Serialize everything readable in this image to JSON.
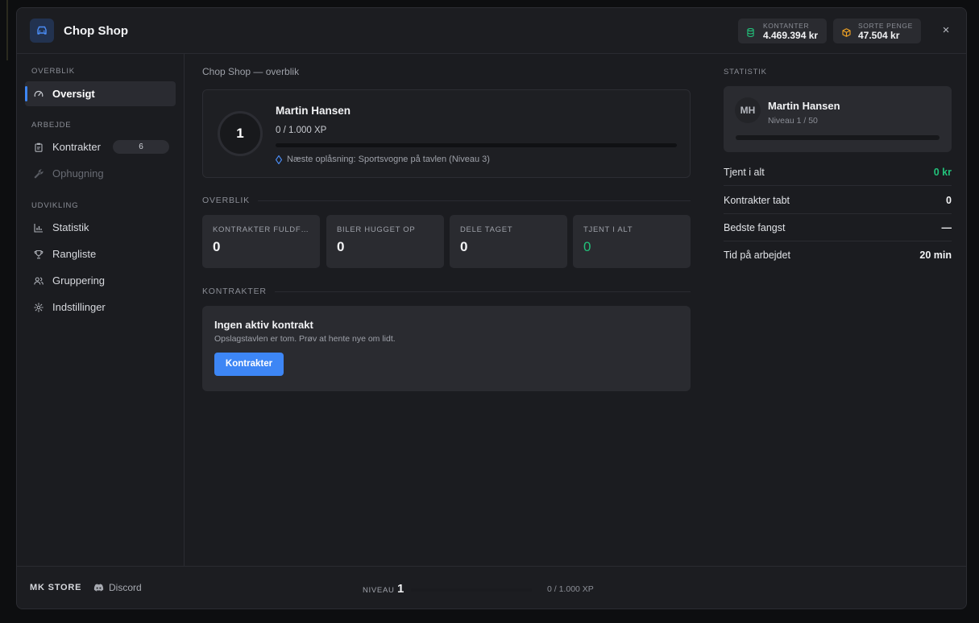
{
  "header": {
    "title": "Chop Shop",
    "wallet": [
      {
        "label": "KONTANTER",
        "value": "4.469.394 kr",
        "icon": "cash-stack-icon",
        "color": "#22c17a"
      },
      {
        "label": "SORTE PENGE",
        "value": "47.504 kr",
        "icon": "box-icon",
        "color": "#f5a524"
      }
    ],
    "close": "×"
  },
  "sidebar": {
    "sections": [
      {
        "label": "OVERBLIK"
      },
      {
        "label": "ARBEJDE"
      },
      {
        "label": "UDVIKLING"
      }
    ],
    "items": [
      {
        "label": "Oversigt",
        "icon": "gauge-icon",
        "active": true
      },
      {
        "label": "Kontrakter",
        "icon": "clipboard-icon",
        "badge": "6"
      },
      {
        "label": "Ophugning",
        "icon": "wrench-icon",
        "disabled": true
      },
      {
        "label": "Statistik",
        "icon": "bar-chart-icon"
      },
      {
        "label": "Rangliste",
        "icon": "trophy-icon"
      },
      {
        "label": "Gruppering",
        "icon": "users-icon"
      },
      {
        "label": "Indstillinger",
        "icon": "gear-icon"
      }
    ]
  },
  "main": {
    "breadcrumb": "Chop Shop — overblik",
    "profile": {
      "level": "1",
      "name": "Martin Hansen",
      "xp": "0 / 1.000 XP",
      "xp_progress": 0,
      "next_unlock": "Næste oplåsning: Sportsvogne på tavlen (Niveau 3)"
    },
    "overview_title": "OVERBLIK",
    "stats": [
      {
        "label": "KONTRAKTER FULDF…",
        "value": "0"
      },
      {
        "label": "BILER HUGGET OP",
        "value": "0"
      },
      {
        "label": "DELE TAGET",
        "value": "0"
      },
      {
        "label": "TJENT I ALT",
        "value": "0"
      }
    ],
    "contracts_title": "KONTRAKTER",
    "contract": {
      "title": "Ingen aktiv kontrakt",
      "subtitle": "Opslagstavlen er tom. Prøv at hente nye om lidt.",
      "button": "Kontrakter"
    }
  },
  "right": {
    "label": "STATISTIK",
    "profile": {
      "initials": "MH",
      "name": "Martin Hansen",
      "level": "Niveau 1 / 50",
      "progress": 0
    },
    "rows": [
      {
        "label": "Tjent i alt",
        "value": "0 kr"
      },
      {
        "label": "Kontrakter tabt",
        "value": "0"
      },
      {
        "label": "Bedste fangst",
        "value": "—"
      },
      {
        "label": "Tid på arbejdet",
        "value": "20 min"
      }
    ]
  },
  "footer": {
    "brand": "MK STORE",
    "discord": "Discord",
    "level_label": "NIVEAU",
    "level_value": "1",
    "xp": "0 / 1.000 XP",
    "xp_progress": 0
  }
}
